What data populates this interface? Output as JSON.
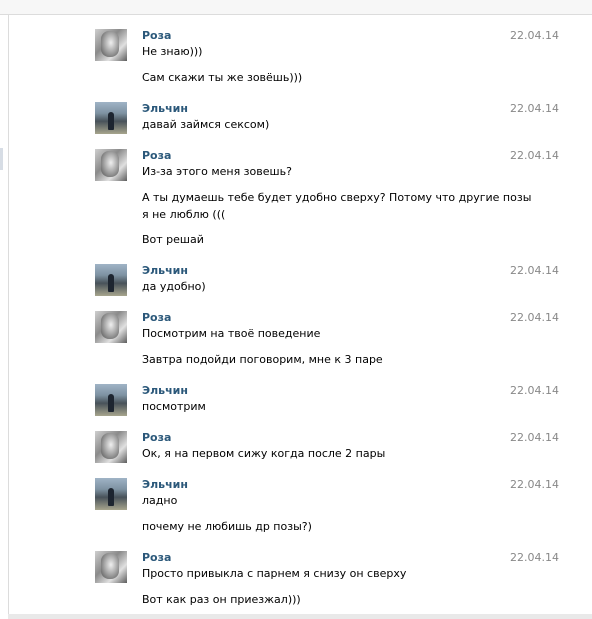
{
  "messages": [
    {
      "author": "Роза",
      "date": "22.04.14",
      "avatar": "roza-avatar",
      "lines": [
        "Не знаю)))",
        "Сам скажи ты же зовёшь)))"
      ]
    },
    {
      "author": "Эльчин",
      "date": "22.04.14",
      "avatar": "elchin-avatar",
      "lines": [
        "давай займся сексом)"
      ]
    },
    {
      "author": "Роза",
      "date": "22.04.14",
      "avatar": "roza-avatar",
      "lines": [
        "Из-за этого меня зовешь?",
        "А ты думаешь тебе будет удобно сверху? Потому что другие позы",
        "я не люблю (((",
        "Вот решай"
      ]
    },
    {
      "author": "Эльчин",
      "date": "22.04.14",
      "avatar": "elchin-avatar",
      "lines": [
        "да удобно)"
      ]
    },
    {
      "author": "Роза",
      "date": "22.04.14",
      "avatar": "roza-avatar",
      "lines": [
        "Посмотрим на твоё поведение",
        "Завтра подойди поговорим, мне к 3 паре"
      ]
    },
    {
      "author": "Эльчин",
      "date": "22.04.14",
      "avatar": "elchin-avatar",
      "lines": [
        "посмотрим"
      ]
    },
    {
      "author": "Роза",
      "date": "22.04.14",
      "avatar": "roza-avatar",
      "lines": [
        "Ок, я на первом сижу когда после 2 пары"
      ]
    },
    {
      "author": "Эльчин",
      "date": "22.04.14",
      "avatar": "elchin-avatar",
      "lines": [
        "ладно",
        "почему не любишь др позы?)"
      ]
    },
    {
      "author": "Роза",
      "date": "22.04.14",
      "avatar": "roza-avatar",
      "lines": [
        "Просто привыкла с парнем я снизу он сверху",
        "Вот как раз он приезжал)))"
      ]
    }
  ],
  "colors": {
    "author": "#2b587a",
    "date": "#888888",
    "text": "#000000"
  }
}
